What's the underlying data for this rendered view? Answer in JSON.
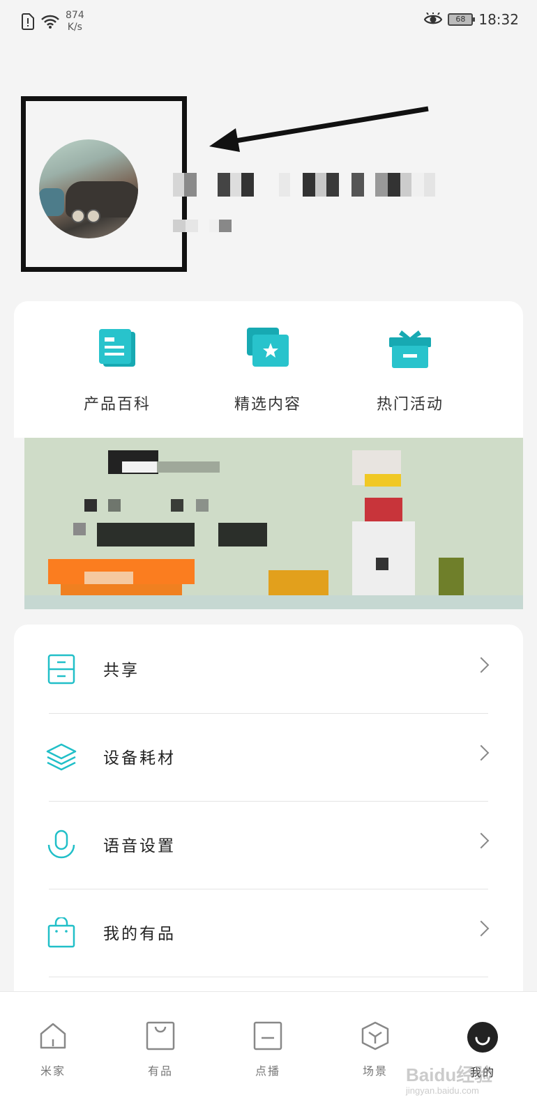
{
  "status_bar": {
    "network_speed_value": "874",
    "network_speed_unit": "K/s",
    "battery": "68",
    "time": "18:32"
  },
  "quick_actions": [
    {
      "label": "产品百科",
      "icon": "document-icon"
    },
    {
      "label": "精选内容",
      "icon": "star-card-icon"
    },
    {
      "label": "热门活动",
      "icon": "gift-icon"
    }
  ],
  "menu": [
    {
      "label": "共享",
      "icon": "cabinet-icon"
    },
    {
      "label": "设备耗材",
      "icon": "layers-icon"
    },
    {
      "label": "语音设置",
      "icon": "microphone-icon"
    },
    {
      "label": "我的有品",
      "icon": "shopping-bag-icon"
    }
  ],
  "tabs": [
    {
      "label": "米家",
      "icon": "home-icon",
      "active": false
    },
    {
      "label": "有品",
      "icon": "bag-icon",
      "active": false
    },
    {
      "label": "点播",
      "icon": "tv-icon",
      "active": false
    },
    {
      "label": "场景",
      "icon": "cube-icon",
      "active": false
    },
    {
      "label": "我的",
      "icon": "smile-icon",
      "active": true
    }
  ],
  "watermark": {
    "brand": "Baidu经验",
    "url": "jingyan.baidu.com"
  },
  "colors": {
    "accent": "#21bfc8",
    "active_tab": "#222222",
    "background": "#f4f4f4"
  }
}
